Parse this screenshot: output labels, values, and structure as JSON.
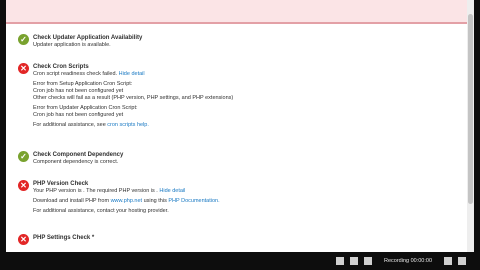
{
  "checks": [
    {
      "status": "ok",
      "title": "Check Updater Application Availability",
      "message": "Updater application is available."
    },
    {
      "status": "error",
      "title": "Check Cron Scripts",
      "message": "Cron script readiness check failed.",
      "hide_link": "Hide detail",
      "details": [
        "Error from Setup Application Cron Script:",
        "Cron job has not been configured yet",
        "Other checks will fail as a result (PHP version, PHP settings, and PHP extensions)"
      ],
      "details2": [
        "Error from Updater Application Cron Script:",
        "Cron job has not been configured yet"
      ],
      "help_prefix": "For additional assistance, see",
      "help_link": "cron scripts help."
    },
    {
      "status": "ok",
      "title": "Check Component Dependency",
      "message": "Component dependency is correct."
    },
    {
      "status": "error",
      "title": "PHP Version Check",
      "message": "Your PHP version is . The required PHP version is .",
      "hide_link": "Hide detail",
      "download_prefix": "Download and install PHP from",
      "download_link1": "www.php.net",
      "download_mid": "using this",
      "download_link2": "PHP Documentation.",
      "assist": "For additional assistance, contact your hosting provider."
    },
    {
      "status": "error",
      "title": "PHP Settings Check *"
    }
  ],
  "taskbar": {
    "recording_text": "Recording 00:00:00"
  },
  "icons": {
    "ok": "check-icon",
    "error": "close-icon"
  },
  "colors": {
    "ok": "#79a22e",
    "error": "#e22626",
    "link": "#1979c3",
    "banner": "#fbe4e6"
  }
}
